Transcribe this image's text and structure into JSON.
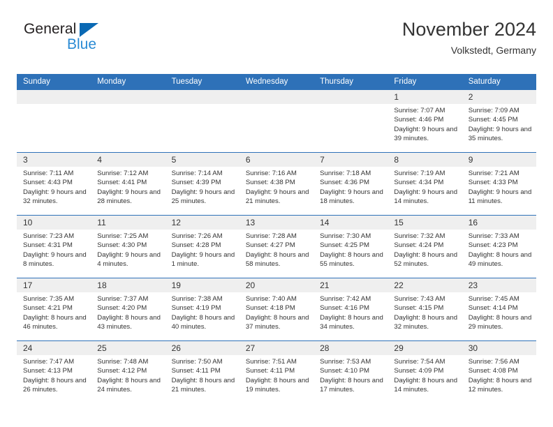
{
  "brand": {
    "name_part1": "General",
    "name_part2": "Blue",
    "triangle_icon": "blue-triangle-icon",
    "colors": {
      "dark": "#231f20",
      "blue": "#2b8bd4",
      "triangle": "#0a69b4"
    }
  },
  "header": {
    "title": "November 2024",
    "subtitle": "Volkstedt, Germany"
  },
  "theme": {
    "header_blue": "#2e71b8",
    "daynum_band": "#efefef",
    "text": "#333333"
  },
  "calendar": {
    "weekday_headers": [
      "Sunday",
      "Monday",
      "Tuesday",
      "Wednesday",
      "Thursday",
      "Friday",
      "Saturday"
    ],
    "weeks": [
      [
        {
          "day": "",
          "sunrise": "",
          "sunset": "",
          "daylight": ""
        },
        {
          "day": "",
          "sunrise": "",
          "sunset": "",
          "daylight": ""
        },
        {
          "day": "",
          "sunrise": "",
          "sunset": "",
          "daylight": ""
        },
        {
          "day": "",
          "sunrise": "",
          "sunset": "",
          "daylight": ""
        },
        {
          "day": "",
          "sunrise": "",
          "sunset": "",
          "daylight": ""
        },
        {
          "day": "1",
          "sunrise": "Sunrise: 7:07 AM",
          "sunset": "Sunset: 4:46 PM",
          "daylight": "Daylight: 9 hours and 39 minutes."
        },
        {
          "day": "2",
          "sunrise": "Sunrise: 7:09 AM",
          "sunset": "Sunset: 4:45 PM",
          "daylight": "Daylight: 9 hours and 35 minutes."
        }
      ],
      [
        {
          "day": "3",
          "sunrise": "Sunrise: 7:11 AM",
          "sunset": "Sunset: 4:43 PM",
          "daylight": "Daylight: 9 hours and 32 minutes."
        },
        {
          "day": "4",
          "sunrise": "Sunrise: 7:12 AM",
          "sunset": "Sunset: 4:41 PM",
          "daylight": "Daylight: 9 hours and 28 minutes."
        },
        {
          "day": "5",
          "sunrise": "Sunrise: 7:14 AM",
          "sunset": "Sunset: 4:39 PM",
          "daylight": "Daylight: 9 hours and 25 minutes."
        },
        {
          "day": "6",
          "sunrise": "Sunrise: 7:16 AM",
          "sunset": "Sunset: 4:38 PM",
          "daylight": "Daylight: 9 hours and 21 minutes."
        },
        {
          "day": "7",
          "sunrise": "Sunrise: 7:18 AM",
          "sunset": "Sunset: 4:36 PM",
          "daylight": "Daylight: 9 hours and 18 minutes."
        },
        {
          "day": "8",
          "sunrise": "Sunrise: 7:19 AM",
          "sunset": "Sunset: 4:34 PM",
          "daylight": "Daylight: 9 hours and 14 minutes."
        },
        {
          "day": "9",
          "sunrise": "Sunrise: 7:21 AM",
          "sunset": "Sunset: 4:33 PM",
          "daylight": "Daylight: 9 hours and 11 minutes."
        }
      ],
      [
        {
          "day": "10",
          "sunrise": "Sunrise: 7:23 AM",
          "sunset": "Sunset: 4:31 PM",
          "daylight": "Daylight: 9 hours and 8 minutes."
        },
        {
          "day": "11",
          "sunrise": "Sunrise: 7:25 AM",
          "sunset": "Sunset: 4:30 PM",
          "daylight": "Daylight: 9 hours and 4 minutes."
        },
        {
          "day": "12",
          "sunrise": "Sunrise: 7:26 AM",
          "sunset": "Sunset: 4:28 PM",
          "daylight": "Daylight: 9 hours and 1 minute."
        },
        {
          "day": "13",
          "sunrise": "Sunrise: 7:28 AM",
          "sunset": "Sunset: 4:27 PM",
          "daylight": "Daylight: 8 hours and 58 minutes."
        },
        {
          "day": "14",
          "sunrise": "Sunrise: 7:30 AM",
          "sunset": "Sunset: 4:25 PM",
          "daylight": "Daylight: 8 hours and 55 minutes."
        },
        {
          "day": "15",
          "sunrise": "Sunrise: 7:32 AM",
          "sunset": "Sunset: 4:24 PM",
          "daylight": "Daylight: 8 hours and 52 minutes."
        },
        {
          "day": "16",
          "sunrise": "Sunrise: 7:33 AM",
          "sunset": "Sunset: 4:23 PM",
          "daylight": "Daylight: 8 hours and 49 minutes."
        }
      ],
      [
        {
          "day": "17",
          "sunrise": "Sunrise: 7:35 AM",
          "sunset": "Sunset: 4:21 PM",
          "daylight": "Daylight: 8 hours and 46 minutes."
        },
        {
          "day": "18",
          "sunrise": "Sunrise: 7:37 AM",
          "sunset": "Sunset: 4:20 PM",
          "daylight": "Daylight: 8 hours and 43 minutes."
        },
        {
          "day": "19",
          "sunrise": "Sunrise: 7:38 AM",
          "sunset": "Sunset: 4:19 PM",
          "daylight": "Daylight: 8 hours and 40 minutes."
        },
        {
          "day": "20",
          "sunrise": "Sunrise: 7:40 AM",
          "sunset": "Sunset: 4:18 PM",
          "daylight": "Daylight: 8 hours and 37 minutes."
        },
        {
          "day": "21",
          "sunrise": "Sunrise: 7:42 AM",
          "sunset": "Sunset: 4:16 PM",
          "daylight": "Daylight: 8 hours and 34 minutes."
        },
        {
          "day": "22",
          "sunrise": "Sunrise: 7:43 AM",
          "sunset": "Sunset: 4:15 PM",
          "daylight": "Daylight: 8 hours and 32 minutes."
        },
        {
          "day": "23",
          "sunrise": "Sunrise: 7:45 AM",
          "sunset": "Sunset: 4:14 PM",
          "daylight": "Daylight: 8 hours and 29 minutes."
        }
      ],
      [
        {
          "day": "24",
          "sunrise": "Sunrise: 7:47 AM",
          "sunset": "Sunset: 4:13 PM",
          "daylight": "Daylight: 8 hours and 26 minutes."
        },
        {
          "day": "25",
          "sunrise": "Sunrise: 7:48 AM",
          "sunset": "Sunset: 4:12 PM",
          "daylight": "Daylight: 8 hours and 24 minutes."
        },
        {
          "day": "26",
          "sunrise": "Sunrise: 7:50 AM",
          "sunset": "Sunset: 4:11 PM",
          "daylight": "Daylight: 8 hours and 21 minutes."
        },
        {
          "day": "27",
          "sunrise": "Sunrise: 7:51 AM",
          "sunset": "Sunset: 4:11 PM",
          "daylight": "Daylight: 8 hours and 19 minutes."
        },
        {
          "day": "28",
          "sunrise": "Sunrise: 7:53 AM",
          "sunset": "Sunset: 4:10 PM",
          "daylight": "Daylight: 8 hours and 17 minutes."
        },
        {
          "day": "29",
          "sunrise": "Sunrise: 7:54 AM",
          "sunset": "Sunset: 4:09 PM",
          "daylight": "Daylight: 8 hours and 14 minutes."
        },
        {
          "day": "30",
          "sunrise": "Sunrise: 7:56 AM",
          "sunset": "Sunset: 4:08 PM",
          "daylight": "Daylight: 8 hours and 12 minutes."
        }
      ]
    ]
  }
}
